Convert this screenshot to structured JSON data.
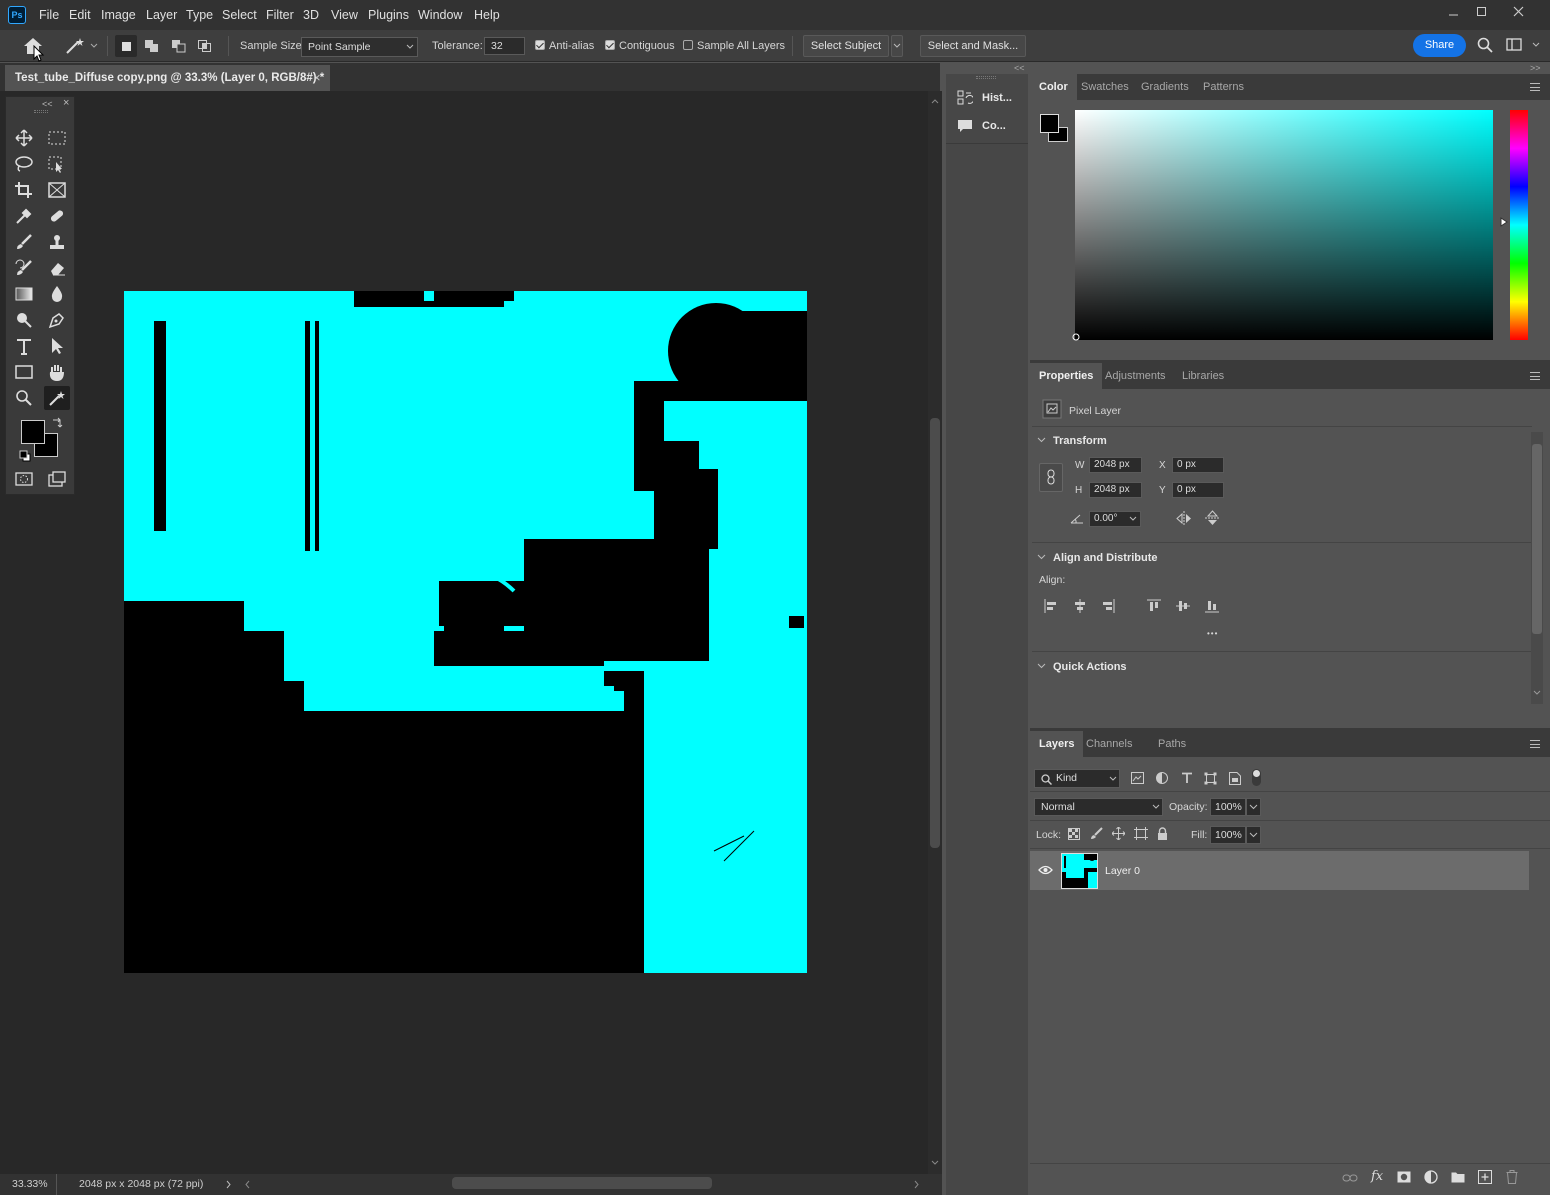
{
  "app": {
    "logo": "Ps"
  },
  "menu": [
    "File",
    "Edit",
    "Image",
    "Layer",
    "Type",
    "Select",
    "Filter",
    "3D",
    "View",
    "Plugins",
    "Window",
    "Help"
  ],
  "options": {
    "sample_size_label": "Sample Size:",
    "sample_size_value": "Point Sample",
    "tolerance_label": "Tolerance:",
    "tolerance_value": "32",
    "anti_alias": "Anti-alias",
    "contiguous": "Contiguous",
    "sample_all_layers": "Sample All Layers",
    "select_subject": "Select Subject",
    "select_and_mask": "Select and Mask...",
    "share": "Share"
  },
  "document": {
    "tab_title": "Test_tube_Diffuse copy.png @ 33.3% (Layer 0, RGB/8#) *",
    "close": "×"
  },
  "status": {
    "zoom": "33.33%",
    "doc_info": "2048 px x 2048 px (72 ppi)"
  },
  "dock": {
    "history": "Hist...",
    "comments": "Co..."
  },
  "color_panel": {
    "tabs": [
      "Color",
      "Swatches",
      "Gradients",
      "Patterns"
    ],
    "hue_color": "#00ffff"
  },
  "properties_panel": {
    "tabs": [
      "Properties",
      "Adjustments",
      "Libraries"
    ],
    "layer_type": "Pixel Layer",
    "transform": {
      "title": "Transform",
      "w_label": "W",
      "w": "2048 px",
      "h_label": "H",
      "h": "2048 px",
      "x_label": "X",
      "x": "0 px",
      "y_label": "Y",
      "y": "0 px",
      "angle": "0.00°"
    },
    "align": {
      "title": "Align and Distribute",
      "label": "Align:",
      "more": "•••"
    },
    "quick_actions": {
      "title": "Quick Actions"
    }
  },
  "layers_panel": {
    "tabs": [
      "Layers",
      "Channels",
      "Paths"
    ],
    "filter_kind": "Kind",
    "blend_mode": "Normal",
    "opacity_label": "Opacity:",
    "opacity": "100%",
    "lock_label": "Lock:",
    "fill_label": "Fill:",
    "fill": "100%",
    "layers": [
      {
        "name": "Layer 0",
        "visible": true
      }
    ]
  },
  "colors": {
    "accent": "#1473e6",
    "image_cyan": "#00ffff"
  }
}
